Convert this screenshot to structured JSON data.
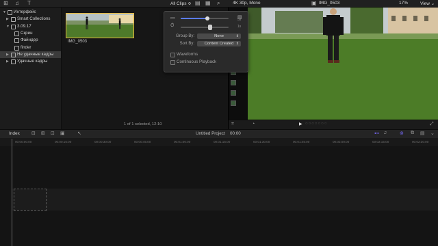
{
  "topbar": {
    "filter_label": "All Clips ≎",
    "format_label": "4K 30p, Mono",
    "clip_name": "IMG_0503",
    "zoom_label": "17%",
    "view_label": "View ⌄"
  },
  "libraries": [
    {
      "label": "Интерфейс",
      "indent": 0,
      "expanded": true,
      "selected": false
    },
    {
      "label": "Smart Collections",
      "indent": 1,
      "expanded": false,
      "selected": false
    },
    {
      "label": "3.09.17",
      "indent": 1,
      "expanded": true,
      "selected": false
    },
    {
      "label": "Скрин",
      "indent": 2,
      "expanded": false,
      "selected": false
    },
    {
      "label": "Файндер",
      "indent": 2,
      "expanded": false,
      "selected": false
    },
    {
      "label": "finder",
      "indent": 2,
      "expanded": false,
      "selected": false
    },
    {
      "label": "Не удачные кадры",
      "indent": 1,
      "expanded": false,
      "selected": true
    },
    {
      "label": "Удачные кадры",
      "indent": 1,
      "expanded": false,
      "selected": false
    }
  ],
  "browser": {
    "clip_label": "IMG_0503",
    "status": "1 of 1 selected, 12:10"
  },
  "popover": {
    "clip_height_value": 0.55,
    "duration_value": 0.62,
    "group_by_label": "Group By:",
    "group_by_value": "None",
    "sort_by_label": "Sort By:",
    "sort_by_value": "Content Created",
    "waveforms_label": "Waveforms",
    "waveforms_checked": false,
    "continuous_label": "Continuous Playback",
    "continuous_checked": false,
    "duration_short": "5s",
    "duration_long": "1s"
  },
  "timeline": {
    "index_label": "Index",
    "project_name": "Untitled Project",
    "project_duration": "00:00",
    "ruler_ticks": [
      "00:00:00:00",
      "00:00:15:00",
      "00:00:30:00",
      "00:00:45:00",
      "00:01:00:00",
      "00:01:15:00",
      "00:01:30:00",
      "00:01:45:00",
      "00:02:00:00",
      "00:02:15:00",
      "00:02:30:00"
    ]
  },
  "colors": {
    "selection_yellow": "#e6b93a",
    "accent_purple": "#7a6cff"
  }
}
